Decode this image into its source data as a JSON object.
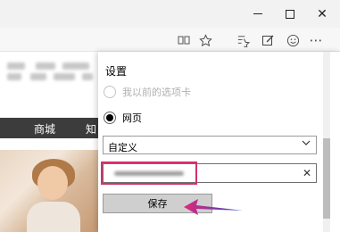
{
  "window": {
    "controls": {
      "minimize_icon": "minimize-icon",
      "maximize_icon": "maximize-icon",
      "close_glyph": "✕"
    }
  },
  "toolbar": {
    "icons": [
      "reading-view-icon",
      "favorite-star-icon",
      "hub-icon",
      "web-note-icon",
      "feedback-smiley-icon",
      "more-icon"
    ],
    "more_glyph": "⋯"
  },
  "page": {
    "nav_items": [
      "商城",
      "知"
    ]
  },
  "settings": {
    "title": "设置",
    "radio_previous_tabs": "我以前的选项卡",
    "radio_web_page": "网页",
    "select_value": "自定义",
    "clear_glyph": "✕",
    "save_label": "保存",
    "colors": {
      "highlight": "#d4306e",
      "arrow_left": "#e0287a",
      "arrow_right": "#2b47c9"
    }
  }
}
